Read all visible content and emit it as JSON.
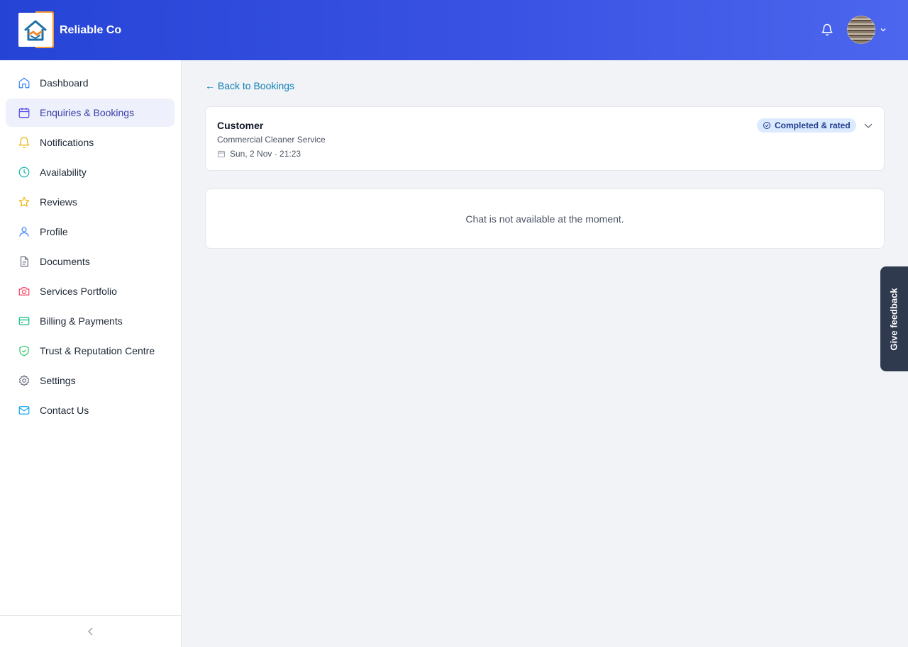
{
  "header": {
    "brand": "Reliable Co"
  },
  "sidebar": {
    "items": [
      {
        "label": "Dashboard",
        "icon": "home-icon",
        "color": "#3b82f6"
      },
      {
        "label": "Enquiries & Bookings",
        "icon": "calendar-icon",
        "color": "#4f46e5",
        "active": true
      },
      {
        "label": "Notifications",
        "icon": "bell-icon",
        "color": "#eab308"
      },
      {
        "label": "Availability",
        "icon": "clock-icon",
        "color": "#14b8a6"
      },
      {
        "label": "Reviews",
        "icon": "star-icon",
        "color": "#eab308"
      },
      {
        "label": "Profile",
        "icon": "user-icon",
        "color": "#3b82f6"
      },
      {
        "label": "Documents",
        "icon": "document-icon",
        "color": "#6b7280"
      },
      {
        "label": "Services Portfolio",
        "icon": "camera-icon",
        "color": "#f43f5e"
      },
      {
        "label": "Billing & Payments",
        "icon": "credit-card-icon",
        "color": "#10b981"
      },
      {
        "label": "Trust & Reputation Centre",
        "icon": "shield-check-icon",
        "color": "#22c55e"
      },
      {
        "label": "Settings",
        "icon": "gear-icon",
        "color": "#6b7280"
      },
      {
        "label": "Contact Us",
        "icon": "mail-icon",
        "color": "#0ea5e9"
      }
    ]
  },
  "main": {
    "back_label": "← Back to Bookings",
    "booking": {
      "customer": "Customer",
      "service": "Commercial Cleaner Service",
      "datetime": "Sun, 2 Nov · 21:23",
      "status": "Completed & rated"
    },
    "chat_message": "Chat is not available at the moment."
  },
  "feedback_label": "Give feedback"
}
